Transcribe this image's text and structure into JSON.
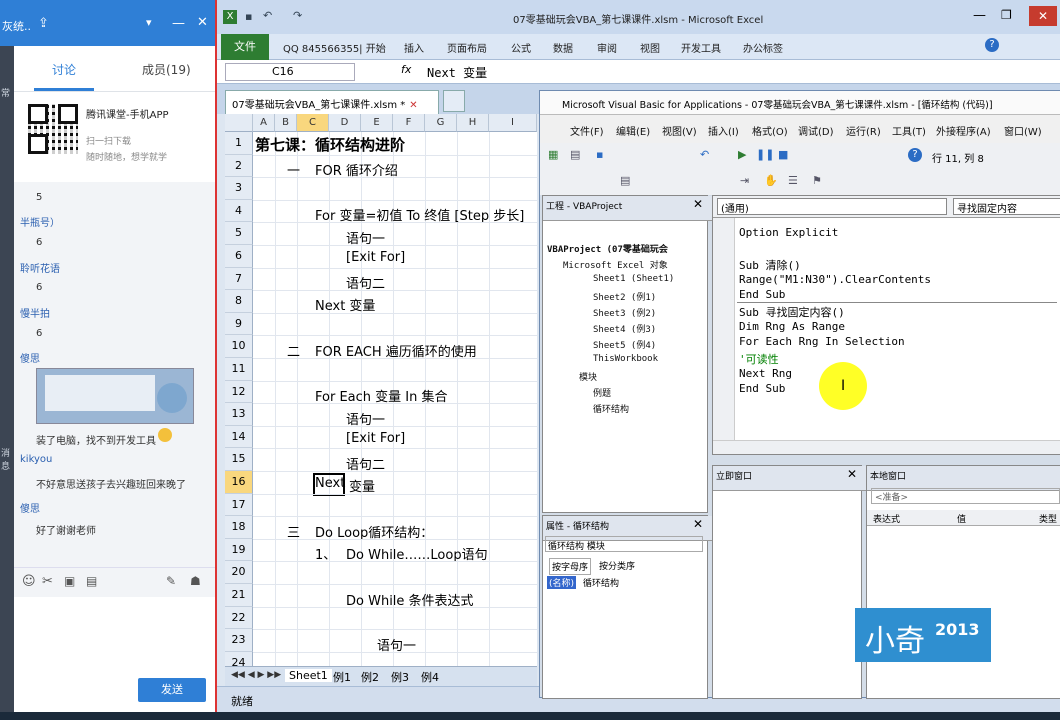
{
  "chat": {
    "tabs": [
      "讨论",
      "成员(19)"
    ],
    "ad_title": "腾讯课堂-手机APP",
    "ad_line1": "扫一扫下载",
    "ad_line2": "随时随地，想学就学",
    "strip": [
      "常",
      "消息"
    ],
    "messages": [
      {
        "text": "5",
        "kind": "value"
      },
      {
        "text": "半瓶号）",
        "kind": "name"
      },
      {
        "text": "6",
        "kind": "value"
      },
      {
        "text": "聆听花语",
        "kind": "name"
      },
      {
        "text": "6",
        "kind": "value"
      },
      {
        "text": "慢半拍",
        "kind": "name"
      },
      {
        "text": "6",
        "kind": "value"
      },
      {
        "text": "傻思",
        "kind": "name"
      }
    ],
    "after_image": [
      {
        "text": "装了电脑，找不到开发工具",
        "kind": "value"
      },
      {
        "text": "kikyou",
        "kind": "name"
      },
      {
        "text": "不好意思送孩子去兴趣班回来晚了",
        "kind": "value"
      },
      {
        "text": "傻思",
        "kind": "name"
      },
      {
        "text": "好了谢谢老师",
        "kind": "value"
      }
    ],
    "send_label": "发送"
  },
  "excel": {
    "title": "07零基础玩会VBA_第七课课件.xlsm - Microsoft Excel",
    "file_tab": "文件",
    "ribbon_tabs": [
      "QQ 845566355| 开始",
      "插入",
      "页面布局",
      "公式",
      "数据",
      "审阅",
      "视图",
      "开发工具",
      "办公标签"
    ],
    "name_box": "C16",
    "fx": "fx",
    "formula": "Next  变量",
    "doc_tab": "07零基础玩会VBA_第七课课件.xlsm *",
    "columns": [
      "A",
      "B",
      "C",
      "D",
      "E",
      "F",
      "G",
      "H",
      "I"
    ],
    "rows": [
      "1",
      "2",
      "3",
      "4",
      "5",
      "6",
      "7",
      "8",
      "9",
      "10",
      "11",
      "12",
      "13",
      "14",
      "15",
      "16",
      "17",
      "18",
      "19",
      "20",
      "21",
      "22",
      "23",
      "24"
    ],
    "cells": {
      "r1": "第七课：循环结构进阶",
      "r2a": "一",
      "r2b": "FOR 循环介绍",
      "r4": "For  变量=初值  To 终值  [Step  步长]",
      "r5": "语句一",
      "r6": "[Exit  For]",
      "r7": "语句二",
      "r8": "Next  变量",
      "r10a": "二",
      "r10b": "FOR EACH 遍历循环的使用",
      "r12": "For Each 变量  In  集合",
      "r13": "语句一",
      "r14": "[Exit  For]",
      "r15": "语句二",
      "r16a": "Next",
      "r16b": "变量",
      "r18a": "三",
      "r18b": "Do Loop循环结构：",
      "r19a": "1、",
      "r19b": "Do While……Loop语句",
      "r21": "Do While 条件表达式",
      "r23": "语句一"
    },
    "sheet_tabs": [
      "Sheet1",
      "例1",
      "例2",
      "例3",
      "例4"
    ],
    "status": "就绪"
  },
  "vba": {
    "title": "Microsoft Visual Basic for Applications - 07零基础玩会VBA_第七课课件.xlsm - [循环结构 (代码)]",
    "menu": [
      "文件(F)",
      "编辑(E)",
      "视图(V)",
      "插入(I)",
      "格式(O)",
      "调试(D)",
      "运行(R)",
      "工具(T)",
      "外接程序(A)",
      "窗口(W)"
    ],
    "cursor_pos": "行 11, 列 8",
    "project_title": "工程 - VBAProject",
    "tree": [
      "VBAProject (07零基础玩会",
      "Microsoft Excel 对象",
      "Sheet1 (Sheet1)",
      "Sheet2 (例1)",
      "Sheet3 (例2)",
      "Sheet4 (例3)",
      "Sheet5 (例4)",
      "ThisWorkbook",
      "模块",
      "例题",
      "循环结构"
    ],
    "props_title": "属性 - 循环结构",
    "props_object": "循环结构 模块",
    "props_tabs": [
      "按字母序",
      "按分类序"
    ],
    "props_name_key": "(名称)",
    "props_name_val": "循环结构",
    "code_object": "(通用)",
    "code_proc": "寻找固定内容",
    "code": [
      "Option Explicit",
      "",
      "Sub 清除()",
      "    Range(\"M1:N30\").ClearContents",
      "End Sub",
      "Sub 寻找固定内容()",
      "    Dim Rng As Range",
      "    For Each Rng In Selection",
      "        '可读性",
      "    Next Rng",
      "End Sub"
    ],
    "immediate_title": "立即窗口",
    "locals_title": "本地窗口",
    "locals_ready": "<准备>",
    "locals_cols": [
      "表达式",
      "值",
      "类型"
    ]
  },
  "watermark": {
    "name": "小奇",
    "year": "2013"
  },
  "colors": {
    "chat_blue": "#2f7fd6",
    "excel_green": "#2e7d32",
    "select_orange": "#f9d77e",
    "comment_green": "#008000",
    "cursor_yellow": "#ffff00"
  }
}
